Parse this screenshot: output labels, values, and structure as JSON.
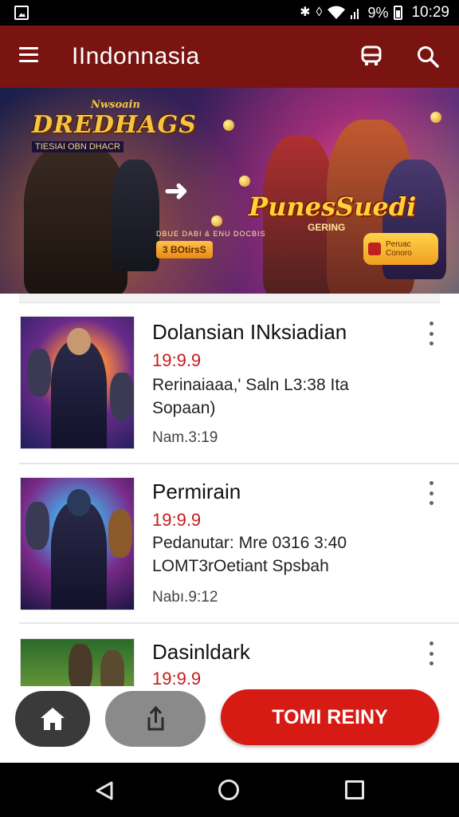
{
  "status_bar": {
    "battery": "9%",
    "time": "10:29"
  },
  "app_bar": {
    "title": "IIndonnasia",
    "menu_icon": "hamburger-menu-icon",
    "cart_icon": "bus-cart-icon",
    "search_icon": "search-icon"
  },
  "banner": {
    "left_logo_top": "Nwsoain",
    "left_logo_main": "DREDHAGS",
    "left_logo_sub": "TIESIAI OBN DHACR",
    "left_tagline": "DBUE DABI & ENU DOCBIS",
    "left_chip": "3 BOtirsS",
    "right_logo_main": "PunesSuedi",
    "right_logo_sub": "GERING",
    "right_chip": "Peruac Conoro"
  },
  "products": [
    {
      "title": "Dolansian INksiadian",
      "price": "19:9.9",
      "desc_line1": "Rerinaiaaa,' Saln L3:38 Ita",
      "desc_line2": "Sopaan)",
      "meta": "Nam.3:19"
    },
    {
      "title": "Permirain",
      "price": "19:9.9",
      "desc_line1": "Pedanutar: Mre 0316 3:40",
      "desc_line2": "LOMT3rOetiant Spsbah",
      "meta": "Nabı.9:12"
    },
    {
      "title": "Dasinldark",
      "price": "19:9.9"
    }
  ],
  "bottom_bar": {
    "home_icon": "home-icon",
    "share_icon": "share-icon",
    "cta_label": "TOMI REINY"
  },
  "nav_bar": {
    "back_icon": "back-triangle-icon",
    "home_icon": "home-circle-icon",
    "recents_icon": "recents-square-icon"
  }
}
